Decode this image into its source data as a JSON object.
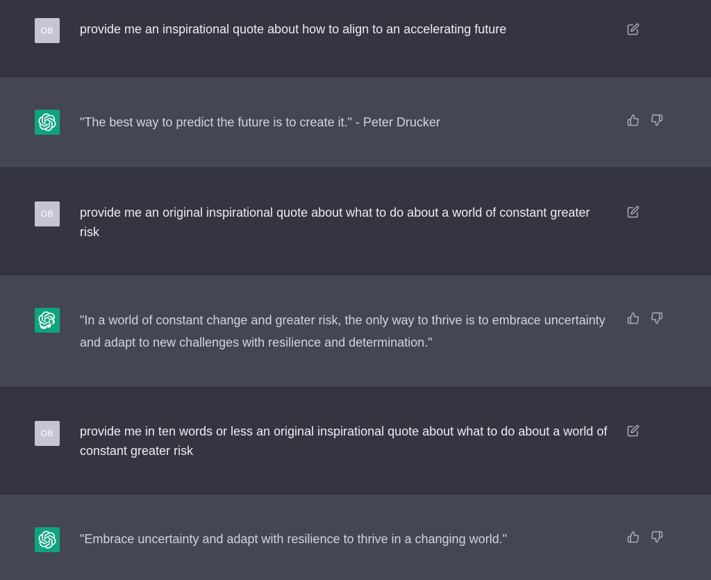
{
  "messages": [
    {
      "role": "user",
      "avatar_initials": "OB",
      "text": "provide me an inspirational quote about how to align to an accelerating future"
    },
    {
      "role": "assistant",
      "text": "\"The best way to predict the future is to create it.\" - Peter Drucker"
    },
    {
      "role": "user",
      "avatar_initials": "OB",
      "text": "provide me an original inspirational quote about what to do about a world of constant greater risk"
    },
    {
      "role": "assistant",
      "text": "\"In a world of constant change and greater risk, the only way to thrive is to embrace uncertainty and adapt to new challenges with resilience and determination.\""
    },
    {
      "role": "user",
      "avatar_initials": "OB",
      "text": "provide me in ten words or less an original inspirational quote about what to do about a world of constant greater risk"
    },
    {
      "role": "assistant",
      "text": "\"Embrace uncertainty and adapt with resilience to thrive in a changing world.\""
    }
  ],
  "icons": {
    "edit": "edit-icon",
    "thumbs_up": "thumbs-up-icon",
    "thumbs_down": "thumbs-down-icon",
    "assistant_logo": "openai-logo-icon"
  },
  "colors": {
    "user_bg": "#343541",
    "assistant_bg": "#444654",
    "assistant_avatar": "#10a37f",
    "user_avatar": "#c5c5d2",
    "text": "#ececf1",
    "icon": "#acacbe"
  }
}
